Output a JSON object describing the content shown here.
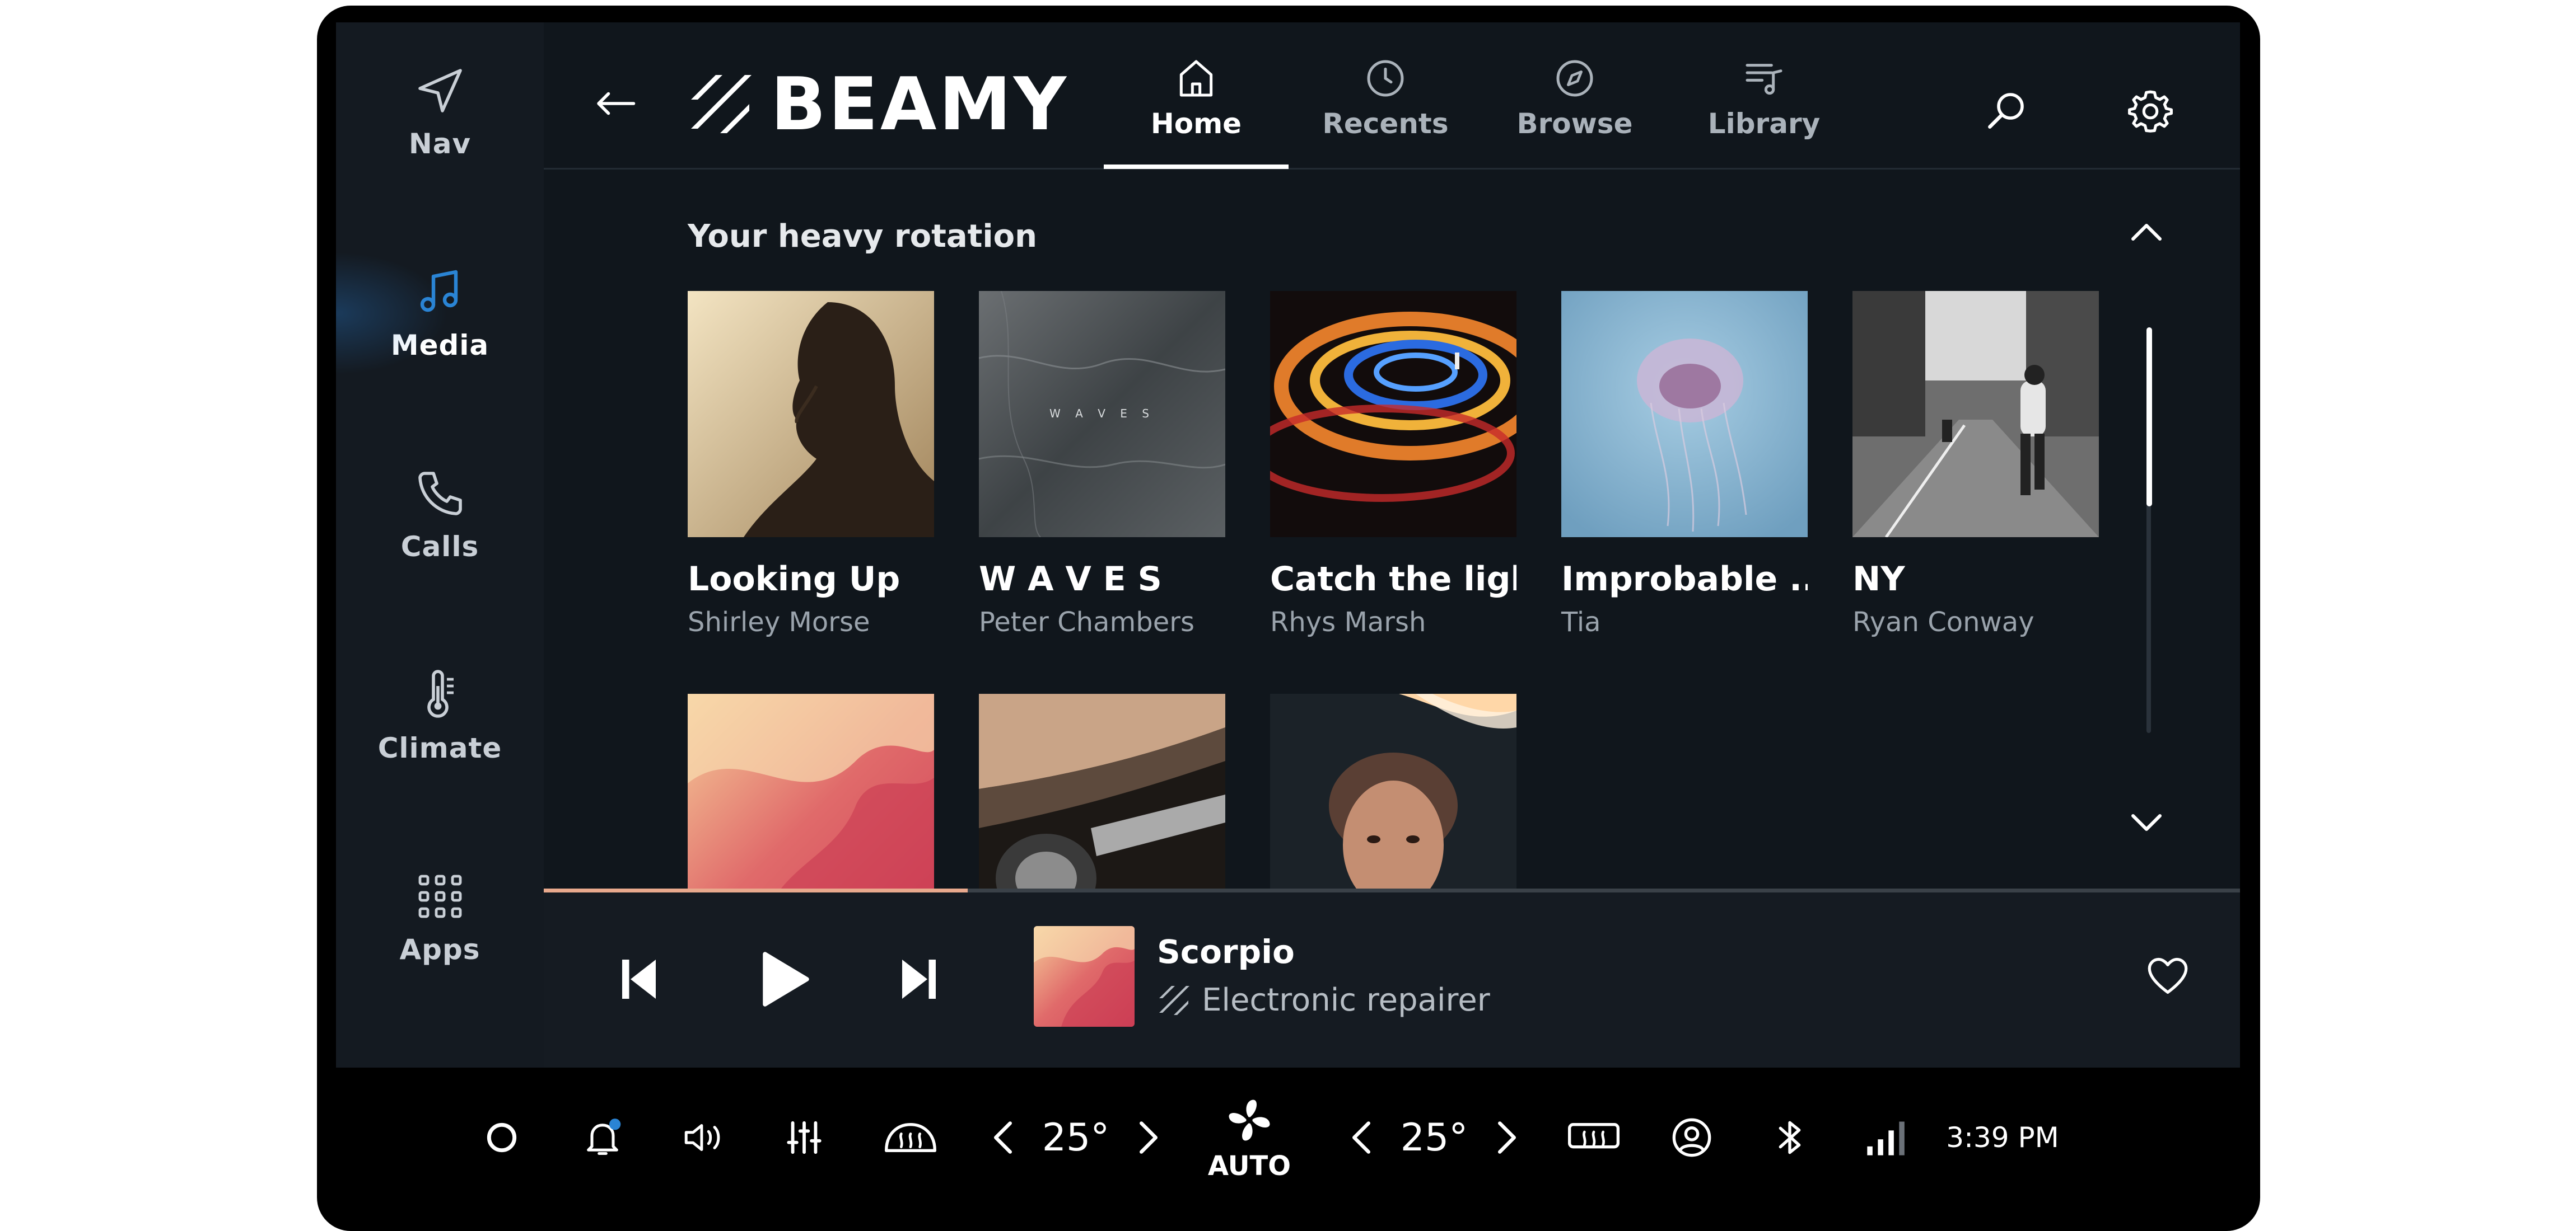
{
  "rail": {
    "items": [
      {
        "label": "Nav",
        "icon": "navigation-arrow-icon"
      },
      {
        "label": "Media",
        "icon": "music-note-icon",
        "active": true
      },
      {
        "label": "Calls",
        "icon": "phone-icon"
      },
      {
        "label": "Climate",
        "icon": "thermometer-icon"
      },
      {
        "label": "Apps",
        "icon": "apps-grid-icon"
      }
    ]
  },
  "header": {
    "brand": "BEAMY",
    "tabs": [
      {
        "label": "Home",
        "icon": "home-icon",
        "active": true
      },
      {
        "label": "Recents",
        "icon": "clock-icon"
      },
      {
        "label": "Browse",
        "icon": "compass-icon"
      },
      {
        "label": "Library",
        "icon": "library-icon"
      }
    ]
  },
  "section": {
    "title": "Your heavy rotation",
    "cards": [
      {
        "title": "Looking Up",
        "artist": "Shirley Morse"
      },
      {
        "title": "W A V E S",
        "artist": "Peter Chambers",
        "art_text": "W A V E S"
      },
      {
        "title": "Catch the light",
        "artist": "Rhys Marsh"
      },
      {
        "title": "Improbable ...",
        "artist": "Tia"
      },
      {
        "title": "NY",
        "artist": "Ryan Conway"
      },
      {
        "title": "",
        "artist": ""
      },
      {
        "title": "",
        "artist": ""
      },
      {
        "title": "",
        "artist": ""
      }
    ]
  },
  "player": {
    "title": "Scorpio",
    "subtitle": "Electronic repairer",
    "progress": 0.25
  },
  "bottombar": {
    "left_temp": "25°",
    "right_temp": "25°",
    "fan_label": "AUTO",
    "time": "3:39 PM"
  },
  "colors": {
    "accent": "#2a84d4",
    "progress": "#e8a98d",
    "background": "#0f1419"
  }
}
